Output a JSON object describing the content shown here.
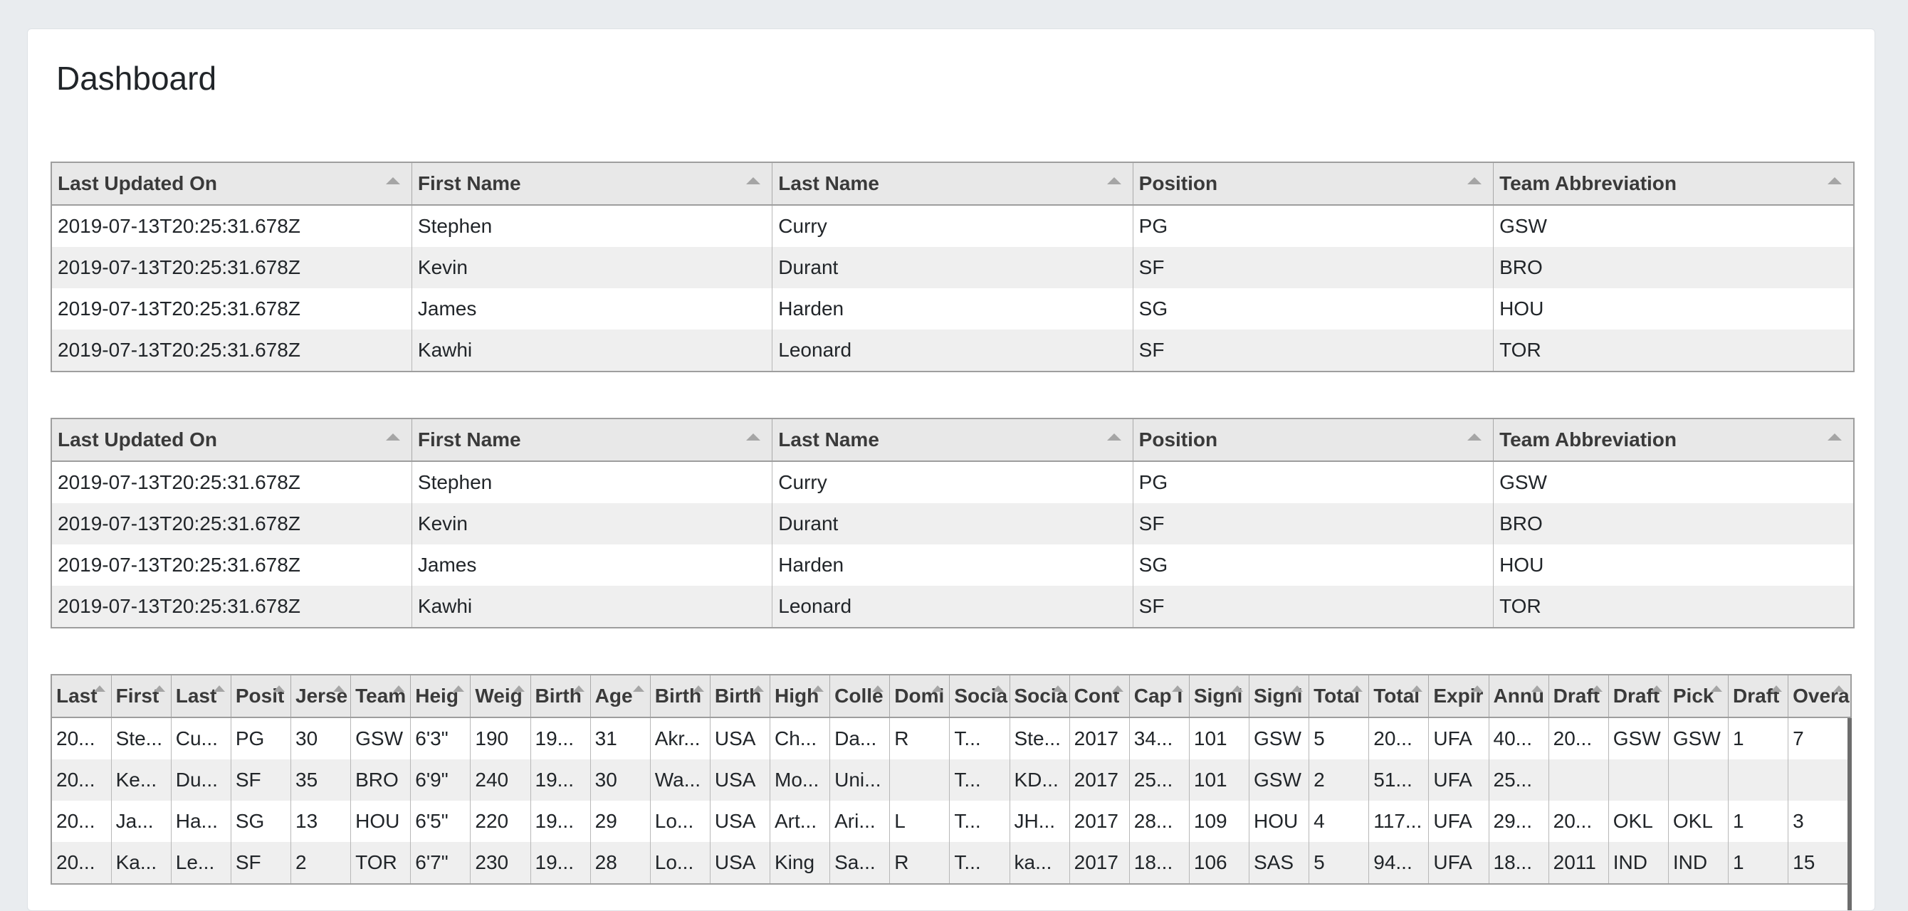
{
  "page": {
    "title": "Dashboard"
  },
  "table1": {
    "columns": [
      "Last Updated On",
      "First Name",
      "Last Name",
      "Position",
      "Team Abbreviation"
    ],
    "rows": [
      [
        "2019-07-13T20:25:31.678Z",
        "Stephen",
        "Curry",
        "PG",
        "GSW"
      ],
      [
        "2019-07-13T20:25:31.678Z",
        "Kevin",
        "Durant",
        "SF",
        "BRO"
      ],
      [
        "2019-07-13T20:25:31.678Z",
        "James",
        "Harden",
        "SG",
        "HOU"
      ],
      [
        "2019-07-13T20:25:31.678Z",
        "Kawhi",
        "Leonard",
        "SF",
        "TOR"
      ]
    ]
  },
  "table2": {
    "columns": [
      "Last Updated On",
      "First Name",
      "Last Name",
      "Position",
      "Team Abbreviation"
    ],
    "rows": [
      [
        "2019-07-13T20:25:31.678Z",
        "Stephen",
        "Curry",
        "PG",
        "GSW"
      ],
      [
        "2019-07-13T20:25:31.678Z",
        "Kevin",
        "Durant",
        "SF",
        "BRO"
      ],
      [
        "2019-07-13T20:25:31.678Z",
        "James",
        "Harden",
        "SG",
        "HOU"
      ],
      [
        "2019-07-13T20:25:31.678Z",
        "Kawhi",
        "Leonard",
        "SF",
        "TOR"
      ]
    ]
  },
  "table3": {
    "columns": [
      "Last",
      "First",
      "Last",
      "Posit",
      "Jerse",
      "Team",
      "Heig",
      "Weig",
      "Birth",
      "Age",
      "Birth",
      "Birth",
      "High",
      "Colle",
      "Domi",
      "Socia",
      "Socia",
      "Cont",
      "Cap I",
      "Signi",
      "Signi",
      "Total",
      "Total",
      "Expir",
      "Annu",
      "Draft",
      "Draft",
      "Pick",
      "Draft",
      "Overa"
    ],
    "rows": [
      [
        "20...",
        "Ste...",
        "Cu...",
        "PG",
        "30",
        "GSW",
        "6'3\"",
        "190",
        "19...",
        "31",
        "Akr...",
        "USA",
        "Ch...",
        "Da...",
        "R",
        "T...",
        "Ste...",
        "2017",
        "34...",
        "101",
        "GSW",
        "5",
        "20...",
        "UFA",
        "40...",
        "20...",
        "GSW",
        "GSW",
        "1",
        "7"
      ],
      [
        "20...",
        "Ke...",
        "Du...",
        "SF",
        "35",
        "BRO",
        "6'9\"",
        "240",
        "19...",
        "30",
        "Wa...",
        "USA",
        "Mo...",
        "Uni...",
        "",
        "T...",
        "KD...",
        "2017",
        "25...",
        "101",
        "GSW",
        "2",
        "51...",
        "UFA",
        "25...",
        "",
        "",
        "",
        "",
        ""
      ],
      [
        "20...",
        "Ja...",
        "Ha...",
        "SG",
        "13",
        "HOU",
        "6'5\"",
        "220",
        "19...",
        "29",
        "Lo...",
        "USA",
        "Art...",
        "Ari...",
        "L",
        "T...",
        "JH...",
        "2017",
        "28...",
        "109",
        "HOU",
        "4",
        "117...",
        "UFA",
        "29...",
        "20...",
        "OKL",
        "OKL",
        "1",
        "3"
      ],
      [
        "20...",
        "Ka...",
        "Le...",
        "SF",
        "2",
        "TOR",
        "6'7\"",
        "230",
        "19...",
        "28",
        "Lo...",
        "USA",
        "King",
        "Sa...",
        "R",
        "T...",
        "ka...",
        "2017",
        "18...",
        "106",
        "SAS",
        "5",
        "94...",
        "UFA",
        "18...",
        "2011",
        "IND",
        "IND",
        "1",
        "15"
      ]
    ]
  }
}
